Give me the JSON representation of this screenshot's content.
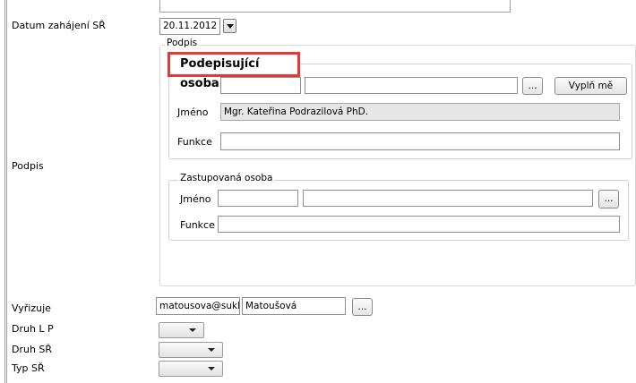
{
  "form": {
    "datum_label": "Datum zahájení SŘ",
    "datum_value": "20.11.2012",
    "podpis_label": "Podpis",
    "podpis_group_legend": "Podpis",
    "podepisujici": {
      "callout": "Podepisující osoba",
      "field1": "",
      "field2": "",
      "ellipsis": "...",
      "fill_button": "Vyplň mě",
      "jmeno_label": "Jméno",
      "jmeno_value": "Mgr. Kateřina Podrazilová PhD.",
      "funkce_label": "Funkce",
      "funkce_value": ""
    },
    "zastupovana": {
      "legend": "Zastupovaná osoba",
      "jmeno_label": "Jméno",
      "jmeno_value1": "",
      "jmeno_value2": "",
      "ellipsis": "...",
      "funkce_label": "Funkce",
      "funkce_value": ""
    },
    "vyrizuje_label": "Vyřizuje",
    "vyrizuje_email": "matousova@sukl.",
    "vyrizuje_name": "Matoušová",
    "vyrizuje_ellipsis": "...",
    "druh_lp_label": "Druh L P",
    "druh_sr_label": "Druh SŘ",
    "typ_sr_label": "Typ SŘ"
  },
  "colors": {
    "callout_border": "#e53935"
  }
}
